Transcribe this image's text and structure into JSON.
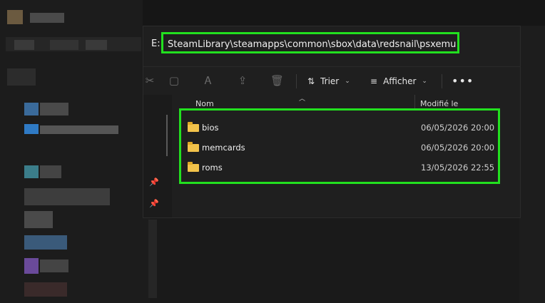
{
  "window": {
    "title": ""
  },
  "address_bar": {
    "drive": "E:",
    "path": "SteamLibrary\\steamapps\\common\\sbox\\data\\redsnail\\psxemu"
  },
  "toolbar": {
    "sort_label": "Trier",
    "view_label": "Afficher",
    "more_label": "•••"
  },
  "columns": {
    "name": "Nom",
    "modified": "Modifié le"
  },
  "files": [
    {
      "name": "bios",
      "modified": "06/05/2026 20:00",
      "icon": "folder-icon"
    },
    {
      "name": "memcards",
      "modified": "06/05/2026 20:00",
      "icon": "folder-icon"
    },
    {
      "name": "roms",
      "modified": "13/05/2026 22:55",
      "icon": "folder-icon"
    }
  ],
  "colors": {
    "highlight": "#22e01f",
    "folder": "#f2c34b"
  }
}
